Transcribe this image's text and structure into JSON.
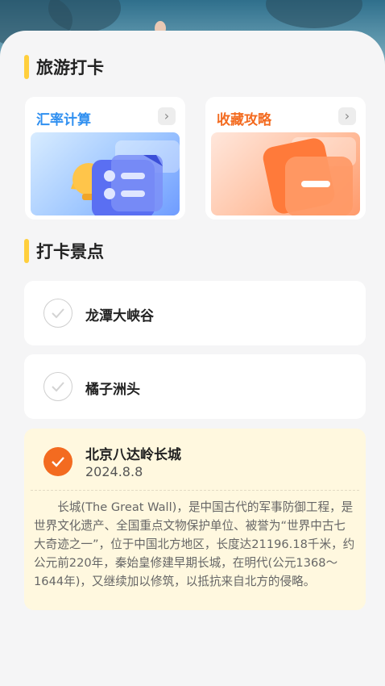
{
  "sections": {
    "travel_checkin_title": "旅游打卡",
    "spots_title": "打卡景点"
  },
  "tools": [
    {
      "label": "汇率计算",
      "color": "#2f8ff0",
      "icon": "calculator-bell-illustration"
    },
    {
      "label": "收藏攻略",
      "color": "#f36b20",
      "icon": "bookmark-cards-illustration"
    }
  ],
  "spots": [
    {
      "name": "龙潭大峡谷",
      "checked": false
    },
    {
      "name": "橘子洲头",
      "checked": false
    },
    {
      "name": "北京八达岭长城",
      "checked": true,
      "date": "2024.8.8",
      "description": "长城(The Great Wall)，是中国古代的军事防御工程，是世界文化遗产、全国重点文物保护单位、被誉为“世界中古七大奇迹之一”，位于中国北方地区，长度达21196.18千米，约公元前220年，秦始皇修建早期长城，在明代(公元1368～1644年)，又继续加以修筑，以抵抗来自北方的侵略。"
    }
  ],
  "colors": {
    "accent_yellow": "#ffcf3d",
    "accent_orange": "#f36b20",
    "accent_blue": "#2f8ff0",
    "active_bg": "#fff8df"
  }
}
